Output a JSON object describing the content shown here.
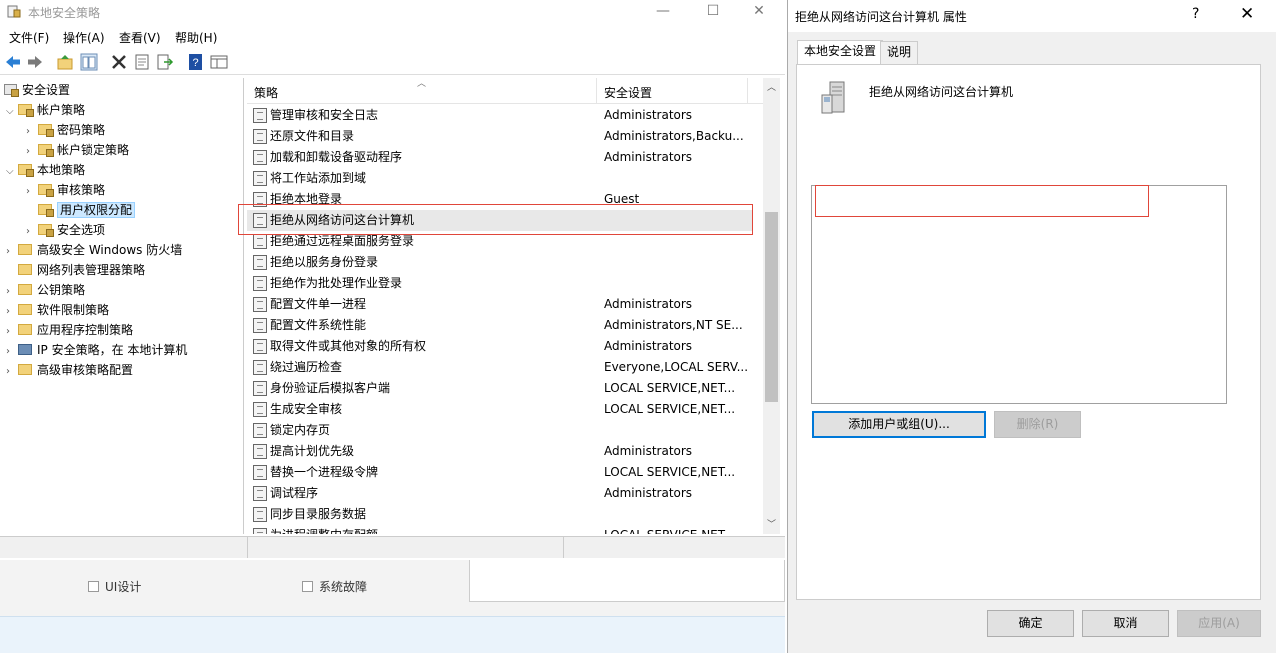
{
  "main_window": {
    "title": "本地安全策略",
    "controls": {
      "minimize": "—",
      "maximize": "☐",
      "close": "✕"
    }
  },
  "menubar": [
    {
      "label": "文件(F)"
    },
    {
      "label": "操作(A)"
    },
    {
      "label": "查看(V)"
    },
    {
      "label": "帮助(H)"
    }
  ],
  "toolbar_icons": [
    "back-icon",
    "forward-icon",
    "up-folder-icon",
    "show-hide-tree-icon",
    "delete-icon",
    "properties-icon",
    "export-icon",
    "help-icon",
    "console-view-icon"
  ],
  "tree": {
    "root": "安全设置",
    "items": [
      {
        "label": "帐户策略"
      },
      {
        "label": "密码策略"
      },
      {
        "label": "帐户锁定策略"
      },
      {
        "label": "本地策略"
      },
      {
        "label": "审核策略"
      },
      {
        "label": "用户权限分配"
      },
      {
        "label": "安全选项"
      },
      {
        "label": "高级安全 Windows 防火墙"
      },
      {
        "label": "网络列表管理器策略"
      },
      {
        "label": "公钥策略"
      },
      {
        "label": "软件限制策略"
      },
      {
        "label": "应用程序控制策略"
      },
      {
        "label": "IP 安全策略，在 本地计算机"
      },
      {
        "label": "高级审核策略配置"
      }
    ]
  },
  "list": {
    "headers": {
      "policy": "策略",
      "setting": "安全设置"
    },
    "rows": [
      {
        "name": "管理审核和安全日志",
        "value": "Administrators"
      },
      {
        "name": "还原文件和目录",
        "value": "Administrators,Backu..."
      },
      {
        "name": "加载和卸载设备驱动程序",
        "value": "Administrators"
      },
      {
        "name": "将工作站添加到域",
        "value": ""
      },
      {
        "name": "拒绝本地登录",
        "value": "Guest"
      },
      {
        "name": "拒绝从网络访问这台计算机",
        "value": ""
      },
      {
        "name": "拒绝通过远程桌面服务登录",
        "value": ""
      },
      {
        "name": "拒绝以服务身份登录",
        "value": ""
      },
      {
        "name": "拒绝作为批处理作业登录",
        "value": ""
      },
      {
        "name": "配置文件单一进程",
        "value": "Administrators"
      },
      {
        "name": "配置文件系统性能",
        "value": "Administrators,NT SE..."
      },
      {
        "name": "取得文件或其他对象的所有权",
        "value": "Administrators"
      },
      {
        "name": "绕过遍历检查",
        "value": "Everyone,LOCAL SERV..."
      },
      {
        "name": "身份验证后模拟客户端",
        "value": "LOCAL SERVICE,NET..."
      },
      {
        "name": "生成安全审核",
        "value": "LOCAL SERVICE,NET..."
      },
      {
        "name": "锁定内存页",
        "value": ""
      },
      {
        "name": "提高计划优先级",
        "value": "Administrators"
      },
      {
        "name": "替换一个进程级令牌",
        "value": "LOCAL SERVICE,NET..."
      },
      {
        "name": "调试程序",
        "value": "Administrators"
      },
      {
        "name": "同步目录服务数据",
        "value": ""
      },
      {
        "name": "为进程调整内存配额",
        "value": "LOCAL SERVICE,NET..."
      }
    ]
  },
  "background": {
    "checkbox1": "UI设计",
    "checkbox2": "系统故障"
  },
  "dialog": {
    "title": "拒绝从网络访问这台计算机 属性",
    "help": "?",
    "close": "✕",
    "tabs": [
      "本地安全设置",
      "说明"
    ],
    "policy_name": "拒绝从网络访问这台计算机",
    "add_button": "添加用户或组(U)...",
    "remove_button": "删除(R)",
    "ok": "确定",
    "cancel": "取消",
    "apply": "应用(A)"
  },
  "colors": {
    "highlight_box": "#e0463a",
    "selection": "#cce8ff",
    "focus": "#0078d7"
  }
}
